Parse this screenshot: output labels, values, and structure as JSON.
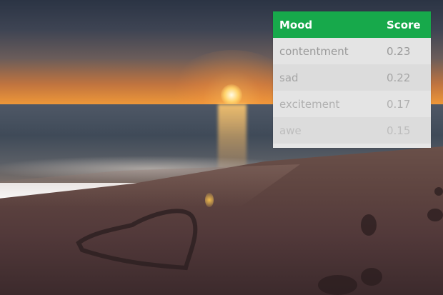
{
  "mood_table": {
    "headers": [
      "Mood",
      "Score"
    ],
    "rows": [
      {
        "mood": "contentment",
        "score": "0.23",
        "color": "#9a9a9a"
      },
      {
        "mood": "sad",
        "score": "0.22",
        "color": "#a6a6a6"
      },
      {
        "mood": "excitement",
        "score": "0.17",
        "color": "#b0b0b0"
      },
      {
        "mood": "awe",
        "score": "0.15",
        "color": "#bdbdbd"
      }
    ],
    "header_color": "#17a94b"
  }
}
